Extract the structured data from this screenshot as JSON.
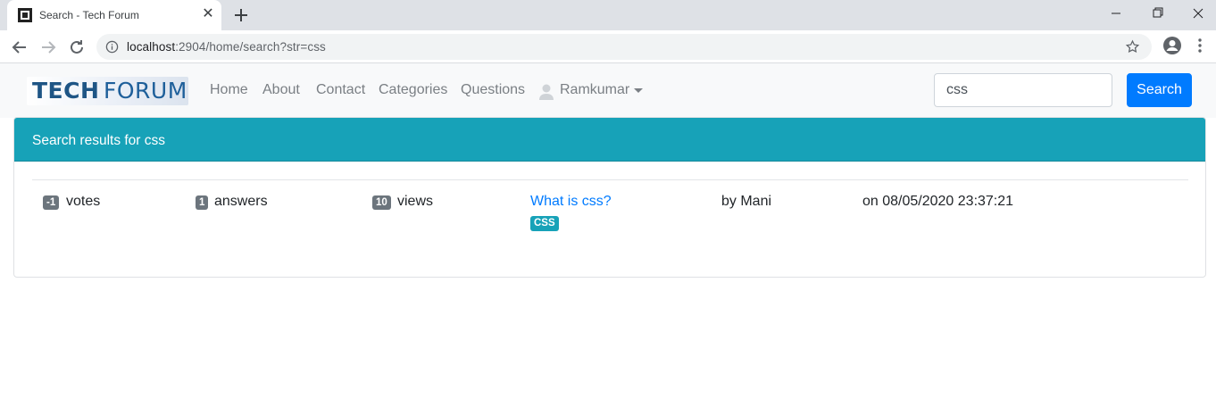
{
  "browser": {
    "tab_title": "Search - Tech Forum",
    "url_host": "localhost",
    "url_rest": ":2904/home/search?str=css"
  },
  "navbar": {
    "brand_tech": "TECH",
    "brand_forum": "FORUM",
    "links": [
      "Home",
      "About",
      "Contact",
      "Categories",
      "Questions"
    ],
    "user": "Ramkumar",
    "search_value": "css",
    "search_button": "Search"
  },
  "results": {
    "header": "Search results for css",
    "items": [
      {
        "votes": "-1",
        "votes_label": "votes",
        "answers": "1",
        "answers_label": "answers",
        "views": "10",
        "views_label": "views",
        "title": "What is css?",
        "tag": "CSS",
        "author": "by Mani",
        "date": "on 08/05/2020 23:37:21"
      }
    ]
  },
  "colors": {
    "primary": "#007bff",
    "info": "#17a2b8",
    "secondary": "#6c757d"
  }
}
